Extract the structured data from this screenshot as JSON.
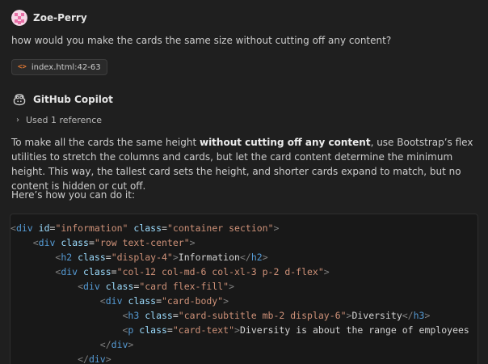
{
  "user_message": {
    "author": "Zoe-Perry",
    "text": "how would you make the cards the same size without cutting off any content?",
    "attachment": {
      "icon": "code-file-icon",
      "icon_glyph": "<>",
      "label": "index.html:42-63"
    }
  },
  "copilot_message": {
    "author": "GitHub Copilot",
    "reference_toggle": "Used 1 reference",
    "paragraph": {
      "before": "To make all the cards the same height ",
      "bold": "without cutting off any content",
      "after": ", use Bootstrap’s flex utilities to stretch the columns and cards, but let the card content determine the minimum height. This way, the tallest card sets the height, and shorter cards expand to match, but no content is hidden or cut off."
    },
    "intro": "Here’s how you can do it:",
    "code_lines": [
      [
        [
          "tag",
          "<"
        ],
        [
          "name",
          "div"
        ],
        [
          "text",
          " "
        ],
        [
          "attr",
          "id"
        ],
        [
          "eq",
          "="
        ],
        [
          "str",
          "\"information\""
        ],
        [
          "text",
          " "
        ],
        [
          "attr",
          "class"
        ],
        [
          "eq",
          "="
        ],
        [
          "str",
          "\"container section\""
        ],
        [
          "tag",
          ">"
        ]
      ],
      [
        [
          "text",
          "    "
        ],
        [
          "tag",
          "<"
        ],
        [
          "name",
          "div"
        ],
        [
          "text",
          " "
        ],
        [
          "attr",
          "class"
        ],
        [
          "eq",
          "="
        ],
        [
          "str",
          "\"row text-center\""
        ],
        [
          "tag",
          ">"
        ]
      ],
      [
        [
          "text",
          "        "
        ],
        [
          "tag",
          "<"
        ],
        [
          "name",
          "h2"
        ],
        [
          "text",
          " "
        ],
        [
          "attr",
          "class"
        ],
        [
          "eq",
          "="
        ],
        [
          "str",
          "\"display-4\""
        ],
        [
          "tag",
          ">"
        ],
        [
          "text",
          "Information"
        ],
        [
          "tag",
          "</"
        ],
        [
          "name",
          "h2"
        ],
        [
          "tag",
          ">"
        ]
      ],
      [
        [
          "text",
          "        "
        ],
        [
          "tag",
          "<"
        ],
        [
          "name",
          "div"
        ],
        [
          "text",
          " "
        ],
        [
          "attr",
          "class"
        ],
        [
          "eq",
          "="
        ],
        [
          "str",
          "\"col-12 col-md-6 col-xl-3 p-2 d-flex\""
        ],
        [
          "tag",
          ">"
        ]
      ],
      [
        [
          "text",
          "            "
        ],
        [
          "tag",
          "<"
        ],
        [
          "name",
          "div"
        ],
        [
          "text",
          " "
        ],
        [
          "attr",
          "class"
        ],
        [
          "eq",
          "="
        ],
        [
          "str",
          "\"card flex-fill\""
        ],
        [
          "tag",
          ">"
        ]
      ],
      [
        [
          "text",
          "                "
        ],
        [
          "tag",
          "<"
        ],
        [
          "name",
          "div"
        ],
        [
          "text",
          " "
        ],
        [
          "attr",
          "class"
        ],
        [
          "eq",
          "="
        ],
        [
          "str",
          "\"card-body\""
        ],
        [
          "tag",
          ">"
        ]
      ],
      [
        [
          "text",
          "                    "
        ],
        [
          "tag",
          "<"
        ],
        [
          "name",
          "h3"
        ],
        [
          "text",
          " "
        ],
        [
          "attr",
          "class"
        ],
        [
          "eq",
          "="
        ],
        [
          "str",
          "\"card-subtitle mb-2 display-6\""
        ],
        [
          "tag",
          ">"
        ],
        [
          "text",
          "Diversity"
        ],
        [
          "tag",
          "</"
        ],
        [
          "name",
          "h3"
        ],
        [
          "tag",
          ">"
        ]
      ],
      [
        [
          "text",
          "                    "
        ],
        [
          "tag",
          "<"
        ],
        [
          "name",
          "p"
        ],
        [
          "text",
          " "
        ],
        [
          "attr",
          "class"
        ],
        [
          "eq",
          "="
        ],
        [
          "str",
          "\"card-text\""
        ],
        [
          "tag",
          ">"
        ],
        [
          "text",
          "Diversity is about the range of employees"
        ]
      ],
      [
        [
          "text",
          "                "
        ],
        [
          "tag",
          "</"
        ],
        [
          "name",
          "div"
        ],
        [
          "tag",
          ">"
        ]
      ],
      [
        [
          "text",
          "            "
        ],
        [
          "tag",
          "</"
        ],
        [
          "name",
          "div"
        ],
        [
          "tag",
          ">"
        ]
      ]
    ]
  },
  "colors": {
    "background": "#1f1f1f",
    "code_background": "#181818",
    "tag": "#808080",
    "tag_name": "#569cd6",
    "attribute": "#9cdcfe",
    "string": "#ce9178",
    "text": "#d4d4d4",
    "chip_icon": "#e37933",
    "avatar_pink": "#e86fa6"
  }
}
